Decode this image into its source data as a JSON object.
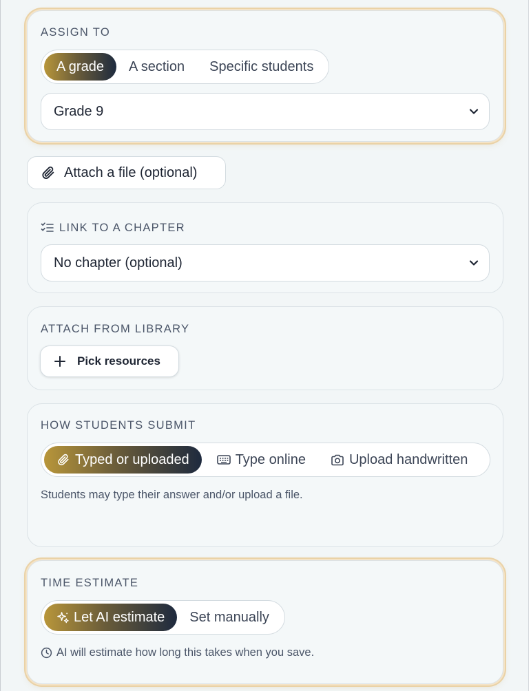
{
  "assign": {
    "label": "ASSIGN TO",
    "options": [
      "A grade",
      "A section",
      "Specific students"
    ],
    "selected": "A grade",
    "grade_value": "Grade 9"
  },
  "attach_file": {
    "label": "Attach a file (optional)",
    "icon": "paperclip-icon"
  },
  "chapter": {
    "label": "LINK TO A CHAPTER",
    "icon": "checklist-icon",
    "value": "No chapter (optional)"
  },
  "library": {
    "label": "ATTACH FROM LIBRARY",
    "button": "Pick resources",
    "icon": "plus-icon"
  },
  "submit": {
    "label": "HOW STUDENTS SUBMIT",
    "options": [
      {
        "label": "Typed or uploaded",
        "icon": "paperclip-icon"
      },
      {
        "label": "Type online",
        "icon": "keyboard-icon"
      },
      {
        "label": "Upload handwritten",
        "icon": "camera-icon"
      }
    ],
    "selected": "Typed or uploaded",
    "hint": "Students may type their answer and/or upload a file."
  },
  "time": {
    "label": "TIME ESTIMATE",
    "options": [
      {
        "label": "Let AI estimate",
        "icon": "sparkle-icon"
      },
      {
        "label": "Set manually",
        "icon": ""
      }
    ],
    "selected": "Let AI estimate",
    "hint": "AI will estimate how long this takes when you save.",
    "hint_icon": "clock-icon"
  },
  "colors": {
    "accent_gold": "#b8963a",
    "accent_navy": "#1e2a3e",
    "highlight_border": "#ead2a6",
    "card_bg": "#f4f8f9"
  }
}
